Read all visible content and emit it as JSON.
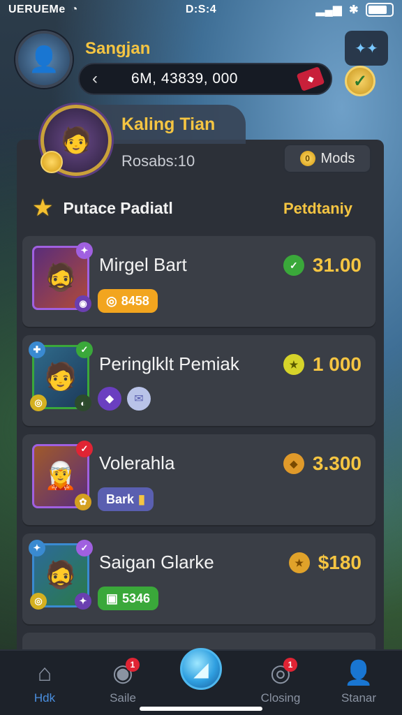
{
  "status_bar": {
    "carrier": "UERUEMe",
    "time": "D:S:4"
  },
  "header": {
    "username": "Sangjan",
    "balance": "6M, 43839, 000",
    "back_icon": "chevron-left-icon",
    "gem_icon": "ruby-gem-icon"
  },
  "profile": {
    "name": "Kaling Tian",
    "rewards": "Rosabs:10",
    "mods_button": "Mods"
  },
  "section": {
    "title": "Putace Padiatl",
    "column_label": "Petdtaniy"
  },
  "rows": [
    {
      "name": "Mirgel Bart",
      "chip": "8458",
      "price": "31.00",
      "colors": {
        "frame": "#8a3fd1",
        "chip": "#f2a51f",
        "price_icon": "#3aa83a"
      }
    },
    {
      "name": "Peringlklt Pemiak",
      "price": "1 000",
      "colors": {
        "frame": "#3aa83a",
        "price_icon": "#d6d42a"
      }
    },
    {
      "name": "Volerahla",
      "chip": "Bark",
      "price": "3.300",
      "colors": {
        "frame": "#8a3fd1",
        "chip": "#5a5fb0",
        "price_icon": "#e09a2a"
      }
    },
    {
      "name": "Saigan Glarke",
      "chip": "5346",
      "price": "$180",
      "colors": {
        "frame": "#2d7ad1",
        "chip": "#3aa83a",
        "price_icon": "#e0a22a"
      }
    }
  ],
  "nav": {
    "items": [
      {
        "label": "Hdk",
        "icon": "home-icon"
      },
      {
        "label": "Saile",
        "icon": "coin-bag-icon",
        "badge": "1"
      },
      {
        "label": "",
        "icon": "crystal-icon"
      },
      {
        "label": "Closing",
        "icon": "compass-icon",
        "badge": "1"
      },
      {
        "label": "Stanar",
        "icon": "user-icon"
      }
    ]
  }
}
